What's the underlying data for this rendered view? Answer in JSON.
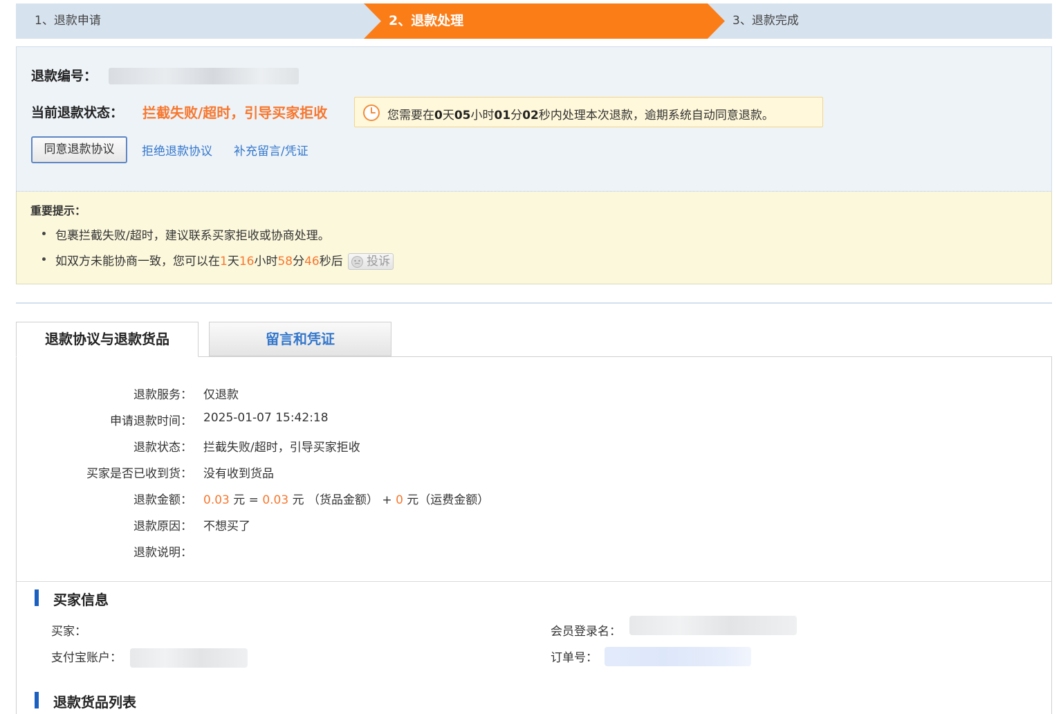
{
  "steps": {
    "step1": "1、退款申请",
    "step2": "2、退款处理",
    "step3": "3、退款完成"
  },
  "info": {
    "refund_no_label": "退款编号：",
    "status_label": "当前退款状态：",
    "status_value": "拦截失败/超时，引导买家拒收",
    "timer": {
      "prefix": "您需要在",
      "days": "0",
      "days_unit": "天",
      "hours": "05",
      "hours_unit": "小时",
      "minutes": "01",
      "minutes_unit": "分",
      "seconds": "02",
      "suffix": "秒内处理本次退款，逾期系统自动同意退款。"
    },
    "agree_button": "同意退款协议",
    "reject_link": "拒绝退款协议",
    "supplement_link": "补充留言/凭证"
  },
  "notice": {
    "title": "重要提示：",
    "item1": "包裹拦截失败/超时，建议联系买家拒收或协商处理。",
    "item2_prefix": "如双方未能协商一致，您可以在",
    "item2_days": "1",
    "item2_days_unit": "天",
    "item2_hours": "16",
    "item2_hours_unit": "小时",
    "item2_minutes": "58",
    "item2_minutes_unit": "分",
    "item2_seconds": "46",
    "item2_suffix": "秒后",
    "complain_button": "投诉"
  },
  "tabs": {
    "active": "退款协议与退款货品",
    "inactive": "留言和凭证"
  },
  "details": [
    {
      "label": "退款服务：",
      "value": "仅退款"
    },
    {
      "label": "申请退款时间：",
      "value": "2025-01-07 15:42:18"
    },
    {
      "label": "退款状态：",
      "value": "拦截失败/超时，引导买家拒收"
    },
    {
      "label": "买家是否已收到货：",
      "value": "没有收到货品"
    },
    {
      "label": "退款金额：",
      "value": ""
    },
    {
      "label": "退款原因：",
      "value": "不想买了"
    },
    {
      "label": "退款说明：",
      "value": ""
    }
  ],
  "amount": {
    "total": "0.03",
    "unit": "元",
    "eq": "=",
    "goods": "0.03",
    "goods_label": "（货品金额）",
    "plus": "+",
    "shipping": "0",
    "shipping_label": "（运费金额）"
  },
  "buyer": {
    "section_title": "买家信息",
    "buyer_label": "买家：",
    "member_label": "会员登录名：",
    "alipay_label": "支付宝账户：",
    "order_label": "订单号："
  },
  "goods": {
    "section_title": "退款货品列表"
  },
  "colors": {
    "accent_orange": "#f7772e",
    "link_blue": "#3377cc",
    "section_bar": "#1b5fbf"
  }
}
